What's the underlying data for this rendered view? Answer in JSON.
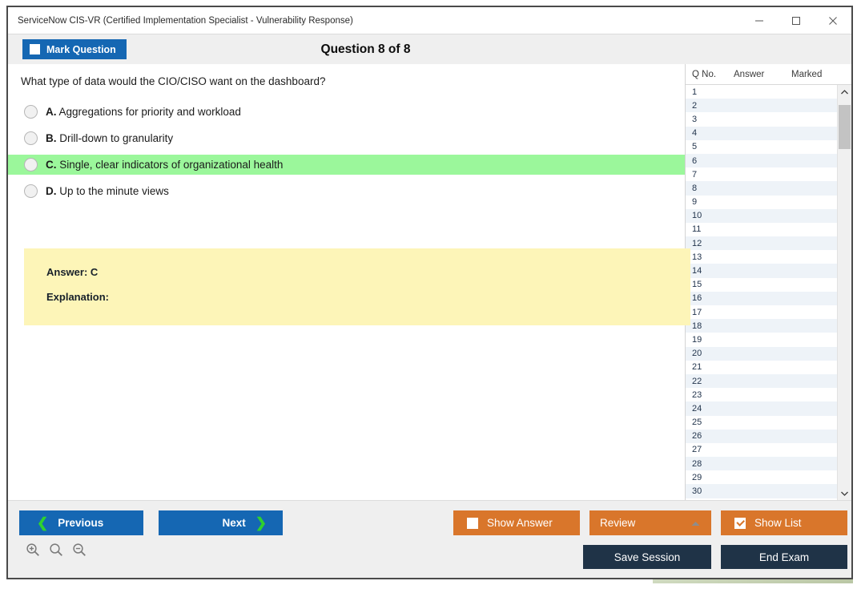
{
  "window": {
    "title": "ServiceNow CIS-VR (Certified Implementation Specialist - Vulnerability Response)",
    "minimize_label": "—",
    "maximize_label": "□",
    "close_label": "✕"
  },
  "header": {
    "mark_question_label": "Mark Question",
    "mark_question_checked": false,
    "question_title": "Question 8 of 8"
  },
  "question": {
    "text": "What type of data would the CIO/CISO want on the dashboard?",
    "options": [
      {
        "letter": "A.",
        "text": "Aggregations for priority and workload",
        "correct": false
      },
      {
        "letter": "B.",
        "text": "Drill-down to granularity",
        "correct": false
      },
      {
        "letter": "C.",
        "text": "Single, clear indicators of organizational health",
        "correct": true
      },
      {
        "letter": "D.",
        "text": "Up to the minute views",
        "correct": false
      }
    ]
  },
  "answer_box": {
    "answer_label": "Answer: C",
    "explanation_label": "Explanation:"
  },
  "question_list": {
    "columns": [
      "Q No.",
      "Answer",
      "Marked"
    ],
    "rows": [
      {
        "no": "1",
        "answer": "",
        "marked": ""
      },
      {
        "no": "2",
        "answer": "",
        "marked": ""
      },
      {
        "no": "3",
        "answer": "",
        "marked": ""
      },
      {
        "no": "4",
        "answer": "",
        "marked": ""
      },
      {
        "no": "5",
        "answer": "",
        "marked": ""
      },
      {
        "no": "6",
        "answer": "",
        "marked": ""
      },
      {
        "no": "7",
        "answer": "",
        "marked": ""
      },
      {
        "no": "8",
        "answer": "",
        "marked": ""
      },
      {
        "no": "9",
        "answer": "",
        "marked": ""
      },
      {
        "no": "10",
        "answer": "",
        "marked": ""
      },
      {
        "no": "11",
        "answer": "",
        "marked": ""
      },
      {
        "no": "12",
        "answer": "",
        "marked": ""
      },
      {
        "no": "13",
        "answer": "",
        "marked": ""
      },
      {
        "no": "14",
        "answer": "",
        "marked": ""
      },
      {
        "no": "15",
        "answer": "",
        "marked": ""
      },
      {
        "no": "16",
        "answer": "",
        "marked": ""
      },
      {
        "no": "17",
        "answer": "",
        "marked": ""
      },
      {
        "no": "18",
        "answer": "",
        "marked": ""
      },
      {
        "no": "19",
        "answer": "",
        "marked": ""
      },
      {
        "no": "20",
        "answer": "",
        "marked": ""
      },
      {
        "no": "21",
        "answer": "",
        "marked": ""
      },
      {
        "no": "22",
        "answer": "",
        "marked": ""
      },
      {
        "no": "23",
        "answer": "",
        "marked": ""
      },
      {
        "no": "24",
        "answer": "",
        "marked": ""
      },
      {
        "no": "25",
        "answer": "",
        "marked": ""
      },
      {
        "no": "26",
        "answer": "",
        "marked": ""
      },
      {
        "no": "27",
        "answer": "",
        "marked": ""
      },
      {
        "no": "28",
        "answer": "",
        "marked": ""
      },
      {
        "no": "29",
        "answer": "",
        "marked": ""
      },
      {
        "no": "30",
        "answer": "",
        "marked": ""
      }
    ]
  },
  "footer": {
    "previous_label": "Previous",
    "next_label": "Next",
    "show_answer_label": "Show Answer",
    "show_answer_checked": false,
    "review_label": "Review",
    "show_list_label": "Show List",
    "show_list_checked": true,
    "save_session_label": "Save Session",
    "end_exam_label": "End Exam"
  },
  "colors": {
    "primary_blue": "#1567b3",
    "orange": "#d9762b",
    "dark_navy": "#1f3347",
    "correct_green": "#9bf79b",
    "answer_yellow": "#fdf5b8",
    "chevron_green": "#2fd12f"
  }
}
